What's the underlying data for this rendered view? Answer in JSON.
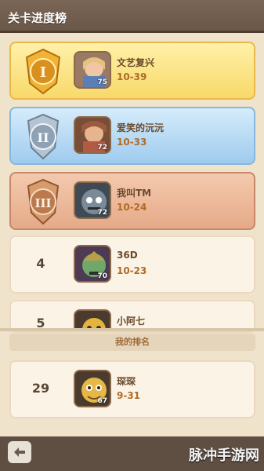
{
  "header": {
    "title": "关卡进度榜"
  },
  "leaderboard": [
    {
      "rank": "I",
      "name": "文艺复兴",
      "stage": "10-39",
      "level": "75"
    },
    {
      "rank": "II",
      "name": "爱笑的沅沅",
      "stage": "10-33",
      "level": "72"
    },
    {
      "rank": "III",
      "name": "我叫TM",
      "stage": "10-24",
      "level": "72"
    },
    {
      "rank": "4",
      "name": "36D",
      "stage": "10-23",
      "level": "70"
    },
    {
      "rank": "5",
      "name": "小阿七",
      "stage": "",
      "level": ""
    }
  ],
  "my_rank": {
    "label": "我的排名",
    "rank": "29",
    "name": "琛琛",
    "stage": "9-31",
    "level": "67"
  },
  "footer": {
    "watermark": "脉冲手游网"
  }
}
